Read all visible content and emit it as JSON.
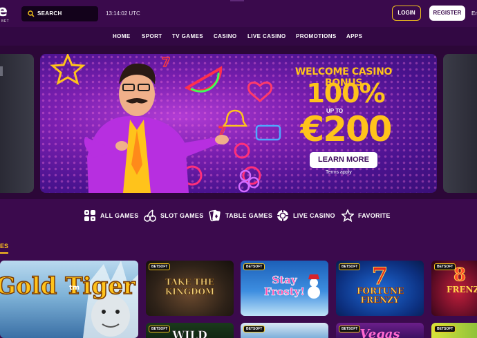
{
  "header": {
    "logo_letter": "e",
    "logo_sub": "BET",
    "search_label": "SEARCH",
    "clock": "13:14:02 UTC",
    "login_label": "LOGIN",
    "register_label": "REGISTER",
    "language": "En"
  },
  "nav": [
    "HOME",
    "SPORT",
    "TV GAMES",
    "CASINO",
    "LIVE CASINO",
    "PROMOTIONS",
    "APPS"
  ],
  "banner": {
    "title": "WELCOME CASINO BONUS",
    "percent": "100%",
    "up_to": "UP TO",
    "amount": "€200",
    "cta": "LEARN MORE",
    "terms": "Terms apply"
  },
  "categories": [
    {
      "label": "ALL GAMES",
      "icon": "all-games-icon"
    },
    {
      "label": "SLOT GAMES",
      "icon": "cherries-icon"
    },
    {
      "label": "TABLE GAMES",
      "icon": "cards-icon"
    },
    {
      "label": "LIVE CASINO",
      "icon": "chip-icon"
    },
    {
      "label": "FAVORITE",
      "icon": "star-icon"
    }
  ],
  "section": {
    "title": "ES"
  },
  "games": [
    {
      "title": "Gold Tiger",
      "badge": ""
    },
    {
      "title": "TAKE THE KINGDOM",
      "badge": "BETSOFT"
    },
    {
      "title": "Stay Frosty!",
      "badge": "BETSOFT"
    },
    {
      "title": "FORTUNE FRENZY",
      "badge": "BETSOFT"
    },
    {
      "title": "FRENZY",
      "badge": "BETSOFT"
    },
    {
      "title": "WILD",
      "badge": "BETSOFT"
    },
    {
      "title": "",
      "badge": "BETSOFT"
    },
    {
      "title": "Vegas",
      "badge": "BETSOFT"
    },
    {
      "title": "",
      "badge": "BETSOFT"
    }
  ],
  "colors": {
    "accent": "#ffc31b",
    "bg": "#3b0a4d",
    "nav": "#320843"
  }
}
